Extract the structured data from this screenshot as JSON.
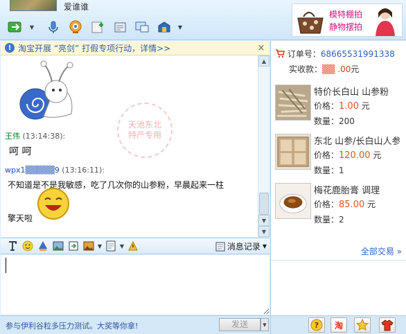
{
  "header": {
    "username": "爱谁谁",
    "toolbar": [
      {
        "name": "transfer-icon"
      },
      {
        "name": "voice-icon"
      },
      {
        "name": "webcam-icon"
      },
      {
        "name": "add-contact-icon"
      },
      {
        "name": "send-file-icon"
      },
      {
        "name": "remote-assist-icon"
      },
      {
        "name": "app-icon"
      }
    ],
    "ad": {
      "line1": "模特棚拍",
      "line2": "静物摆拍"
    }
  },
  "notice": {
    "text": "淘宝开展 “亮剑” 打假专项行动，详情>>",
    "close": "×"
  },
  "chat": {
    "watermark_line1": "天池东北",
    "watermark_line2": "特产专用",
    "messages": [
      {
        "sender": "王伟",
        "time": "(13:14:38):",
        "body": "呵  呵"
      },
      {
        "sender": "wpx1▒▒▒▒▒9",
        "time": "(13:16:11):",
        "body": "不知道是不是我敏感，吃了几次你的山参粉，早晨起来一柱",
        "body2": "擎天啦"
      }
    ]
  },
  "format_toolbar": {
    "history_label": "消息记录"
  },
  "bottom": {
    "link": "参与伊利谷粒多压力测试。大奖等你拿!",
    "send_label": "发送"
  },
  "order": {
    "id_label": "订单号：",
    "id": "68665531991338",
    "paid_label": "实收款：",
    "paid_value": "▒▒ .00",
    "paid_unit": "元",
    "items": [
      {
        "title": "特价长白山 山参粉",
        "price_label": "价格：",
        "price": "1.00",
        "unit": "元",
        "qty_label": "数量：",
        "qty": "200"
      },
      {
        "title": "东北 山参/长白山人参",
        "price_label": "价格：",
        "price": "120.00",
        "unit": "元",
        "qty_label": "数量：",
        "qty": "1"
      },
      {
        "title": "梅花鹿胎膏 调理",
        "price_label": "价格：",
        "price": "85.00",
        "unit": "元",
        "qty_label": "数量：",
        "qty": "2"
      }
    ],
    "all_trades": "全部交易 »"
  },
  "colors": {
    "accent_blue": "#2b62b6",
    "price_orange": "#e8541c",
    "ad_pink": "#c8197c"
  }
}
